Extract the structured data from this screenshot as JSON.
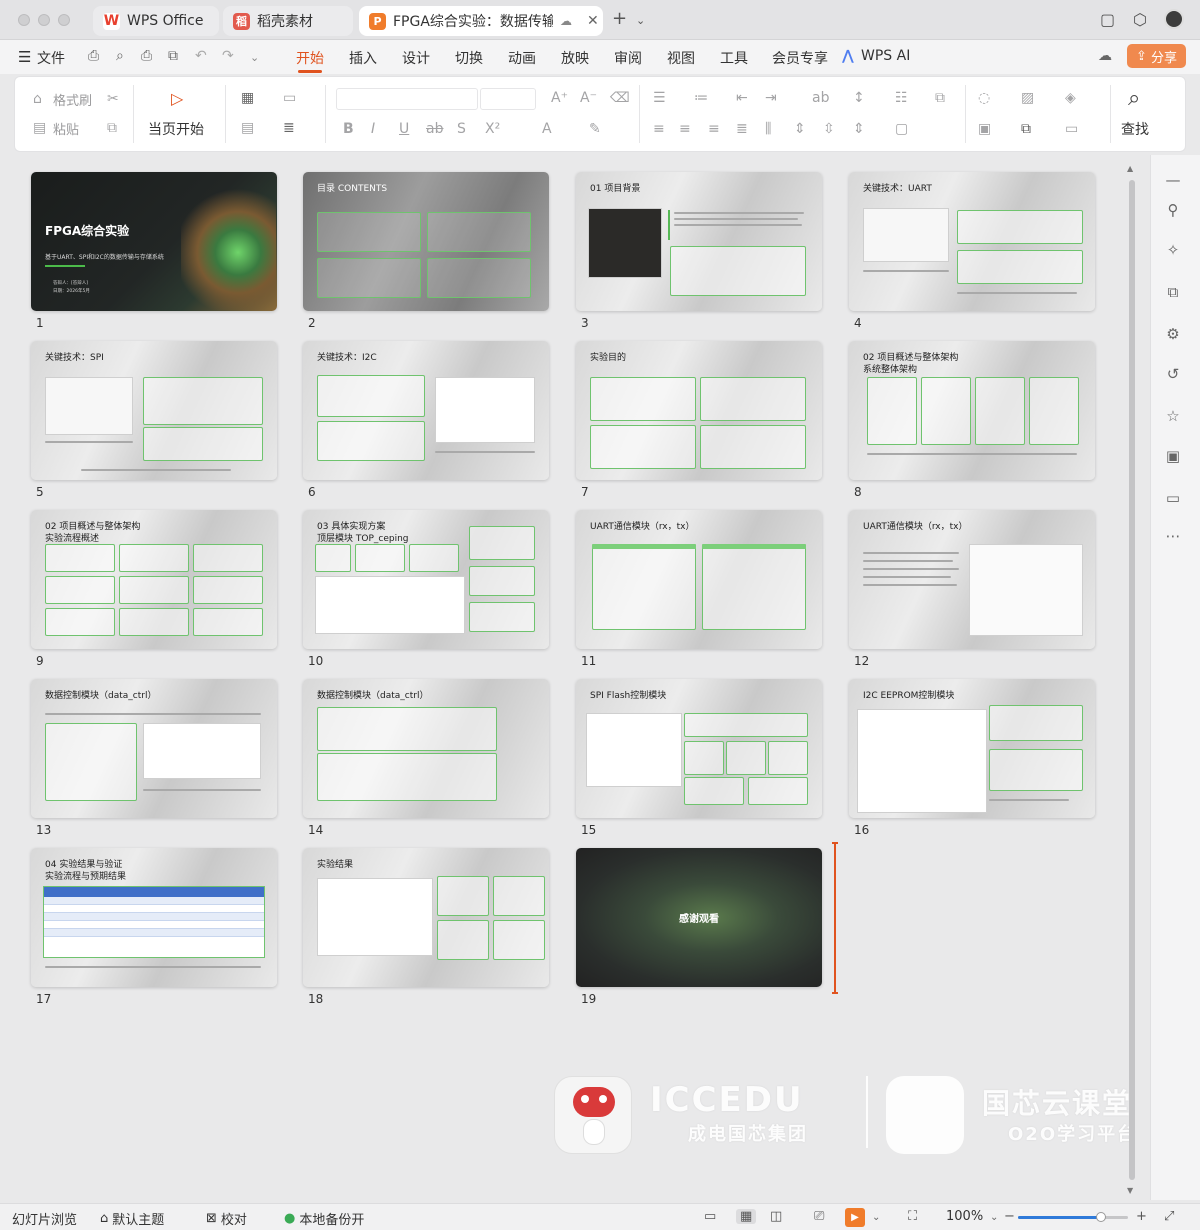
{
  "tabs": [
    {
      "label": "WPS Office",
      "logo": "W",
      "logo_color": "#e8402f"
    },
    {
      "label": "稻壳素材",
      "logo": "稻",
      "logo_color": "#e25a4d"
    },
    {
      "label": "FPGA综合实验：数据传输",
      "logo": "P",
      "logo_color": "#f07c2b"
    }
  ],
  "menu": {
    "file": "文件",
    "items": [
      "开始",
      "插入",
      "设计",
      "切换",
      "动画",
      "放映",
      "审阅",
      "视图",
      "工具",
      "会员专享"
    ],
    "active": "开始",
    "ai": "WPS AI",
    "share": "分享"
  },
  "ribbon": {
    "format_painter": "格式刷",
    "paste": "粘贴",
    "play_from_current": "当页开始",
    "find": "查找"
  },
  "slides": [
    {
      "num": "1",
      "title": "FPGA综合实验",
      "subtitle": "基于UART、SPI和I2C的数据传输与存储系统",
      "author": "答辩人：[答辩人]",
      "date": "日期：2026年5月"
    },
    {
      "num": "2",
      "title": "目录 CONTENTS"
    },
    {
      "num": "3",
      "title": "01 项目背景"
    },
    {
      "num": "4",
      "title": "关键技术：UART"
    },
    {
      "num": "5",
      "title": "关键技术：SPI"
    },
    {
      "num": "6",
      "title": "关键技术：I2C"
    },
    {
      "num": "7",
      "title": "实验目的"
    },
    {
      "num": "8",
      "title": "02 项目概述与整体架构\n系统整体架构"
    },
    {
      "num": "9",
      "title": "02 项目概述与整体架构\n实验流程概述"
    },
    {
      "num": "10",
      "title": "03 具体实现方案\n顶层模块 TOP_ceping"
    },
    {
      "num": "11",
      "title": "UART通信模块（rx，tx）"
    },
    {
      "num": "12",
      "title": "UART通信模块（rx，tx）"
    },
    {
      "num": "13",
      "title": "数据控制模块（data_ctrl）"
    },
    {
      "num": "14",
      "title": "数据控制模块（data_ctrl）"
    },
    {
      "num": "15",
      "title": "SPI Flash控制模块"
    },
    {
      "num": "16",
      "title": "I2C EEPROM控制模块"
    },
    {
      "num": "17",
      "title": "04 实验结果与验证\n实验流程与预期结果"
    },
    {
      "num": "18",
      "title": "实验结果"
    },
    {
      "num": "19",
      "title": "感谢观看"
    }
  ],
  "watermark": {
    "left_brand": "ICCEDU",
    "left_sub": "成电国芯集团",
    "right_brand": "国芯云课堂",
    "right_sub": "O2O学习平台"
  },
  "status": {
    "view": "幻灯片浏览",
    "theme": "默认主题",
    "proof": "校对",
    "backup": "本地备份开",
    "zoom": "100%",
    "zoom_value": 100
  }
}
